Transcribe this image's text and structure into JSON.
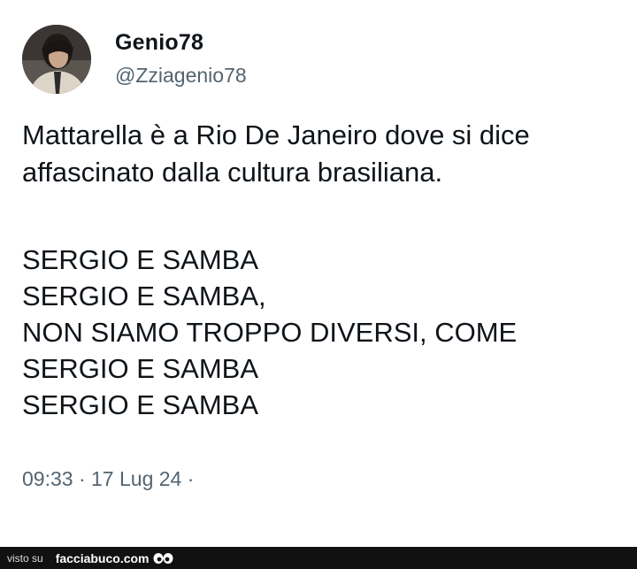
{
  "tweet": {
    "display_name": "Genio78",
    "handle": "@Zziagenio78",
    "paragraph": "Mattarella è a Rio De Janeiro dove si dice affascinato dalla cultura brasiliana.",
    "lines": [
      "SERGIO E SAMBA",
      "SERGIO E SAMBA,",
      "NON SIAMO TROPPO DIVERSI, COME",
      "SERGIO E SAMBA",
      "SERGIO E SAMBA"
    ],
    "time": "09:33",
    "date": "17 Lug 24",
    "separator": "·"
  },
  "footer": {
    "visto_su": "visto su",
    "site": "facciabuco.com"
  },
  "colors": {
    "text": "#0f1419",
    "secondary": "#536471",
    "footer_bg": "#111111"
  },
  "icons": {
    "avatar": "profile-photo",
    "footer_logo": "eyes-icon"
  }
}
